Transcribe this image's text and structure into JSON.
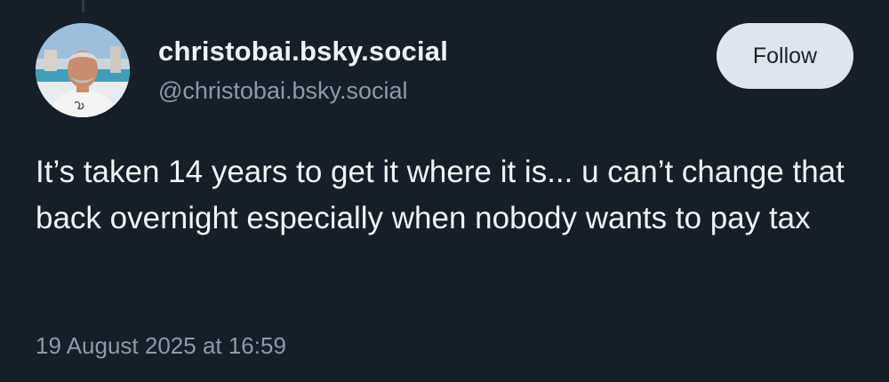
{
  "post": {
    "author": {
      "display_name": "christobai.bsky.social",
      "handle": "@christobai.bsky.social"
    },
    "follow_label": "Follow",
    "text": "It’s taken 14 years to get it where it is... u can’t change that back overnight especially when nobody wants to pay tax",
    "timestamp": "19 August 2025 at 16:59"
  },
  "colors": {
    "background": "#161e27",
    "primary_text": "#f1f3f5",
    "secondary_text": "#8d9aab",
    "button_background": "#dfe5ec"
  }
}
